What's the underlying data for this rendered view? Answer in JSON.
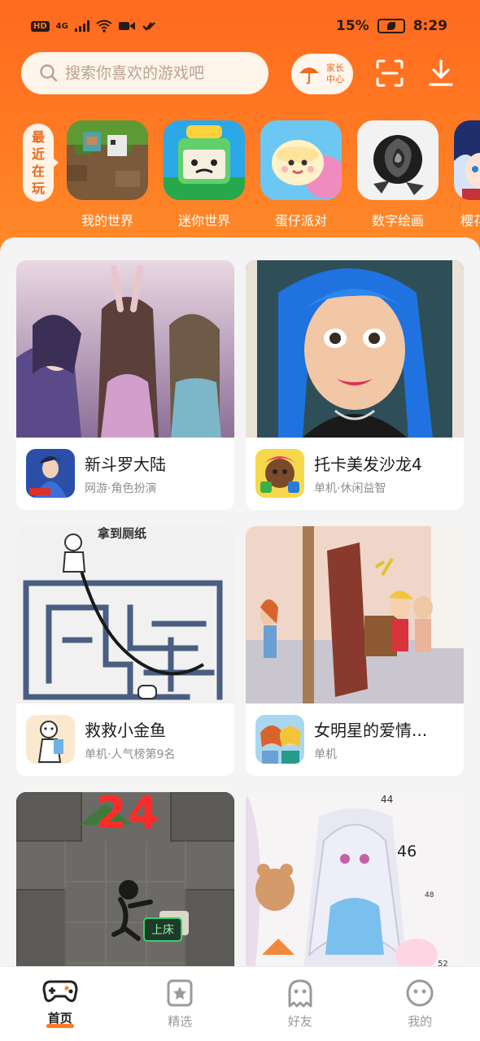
{
  "status": {
    "network": "4G",
    "battery": "15%",
    "time": "8:29",
    "hd": "HD"
  },
  "header": {
    "search_placeholder": "搜索你喜欢的游戏吧",
    "parent_center": "家长中心"
  },
  "recent": {
    "tag": [
      "最",
      "近",
      "在",
      "玩"
    ],
    "games": [
      {
        "label": "我的世界",
        "icon": "minecraft-icon"
      },
      {
        "label": "迷你世界",
        "icon": "mini-world-icon"
      },
      {
        "label": "蛋仔派对",
        "icon": "eggy-party-icon"
      },
      {
        "label": "数字绘画",
        "icon": "paint-by-number-icon"
      },
      {
        "label": "樱花",
        "icon": "sakura-icon"
      }
    ]
  },
  "cards": [
    {
      "title": "新斗罗大陆",
      "sub": "网游·角色扮演"
    },
    {
      "title": "托卡美发沙龙4",
      "sub": "单机·休闲益智"
    },
    {
      "title": "救救小金鱼",
      "sub": "单机·人气榜第9名",
      "banner": "拿到厕纸"
    },
    {
      "title": "女明星的爱情...",
      "sub": "单机"
    },
    {
      "title": "",
      "sub": "",
      "banner": "24",
      "button": "上床"
    },
    {
      "title": "",
      "sub": "",
      "numbers": [
        "44",
        "46",
        "48",
        "52"
      ]
    }
  ],
  "nav": [
    {
      "label": "首页",
      "active": true
    },
    {
      "label": "精选",
      "active": false
    },
    {
      "label": "好友",
      "active": false
    },
    {
      "label": "我的",
      "active": false
    }
  ],
  "colors": {
    "accent": "#ff7a22",
    "header": "#ff6a1f"
  }
}
